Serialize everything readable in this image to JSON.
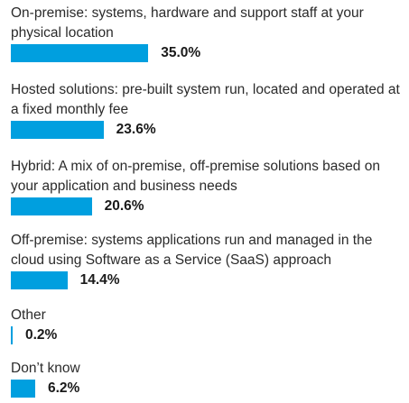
{
  "colors": {
    "bar": "#009fdf"
  },
  "chart_data": {
    "type": "bar",
    "orientation": "horizontal",
    "categories": [
      "On-premise: systems, hardware and support staff at your physical location",
      "Hosted solutions: pre-built system run, located and operated at a fixed monthly fee",
      "Hybrid: A mix of on-premise, off-premise solutions based on your application and business needs",
      "Off-premise: systems applications run and managed in the cloud using Software as a Service (SaaS) approach",
      "Other",
      "Don’t know"
    ],
    "values": [
      35.0,
      23.6,
      20.6,
      14.4,
      0.2,
      6.2
    ],
    "value_labels": [
      "35.0%",
      "23.6%",
      "20.6%",
      "14.4%",
      "0.2%",
      "6.2%"
    ],
    "xlim": [
      0,
      100
    ],
    "grid": false,
    "legend": "none"
  }
}
